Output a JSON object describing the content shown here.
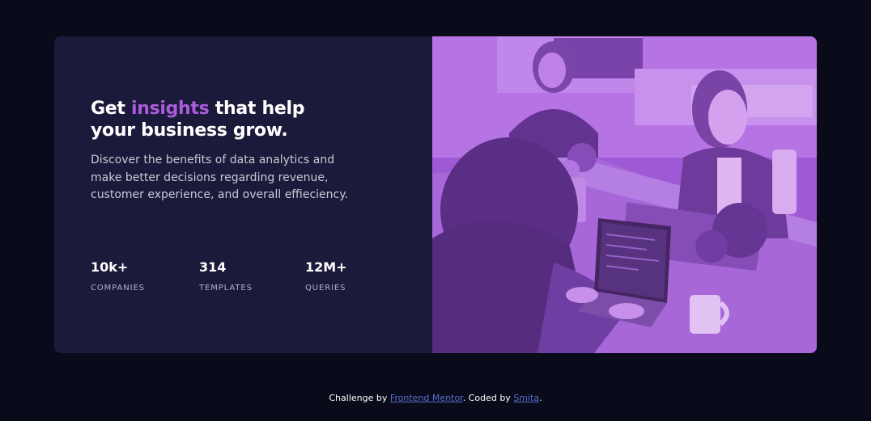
{
  "hero": {
    "headline_pre": "Get ",
    "headline_accent": "insights",
    "headline_post": " that help your business grow.",
    "description": "Discover the benefits of data analytics and make better decisions regarding revenue, customer experience, and overall effieciency.",
    "stats": [
      {
        "value": "10k+",
        "label": "COMPANIES"
      },
      {
        "value": "314",
        "label": "TEMPLATES"
      },
      {
        "value": "12M+",
        "label": "QUERIES"
      }
    ]
  },
  "image": {
    "icon": "photo-of-people-working-at-desk",
    "tint_color": "#aa5cdb"
  },
  "footer": {
    "text1": "Challenge by ",
    "link1": "Frontend Mentor",
    "text2": ". Coded by ",
    "link2": "Smita",
    "text3": "."
  },
  "colors": {
    "background": "#090b1a",
    "card": "#1c1a3a",
    "accent": "#aa5cdb",
    "link": "#5a6fcf"
  }
}
